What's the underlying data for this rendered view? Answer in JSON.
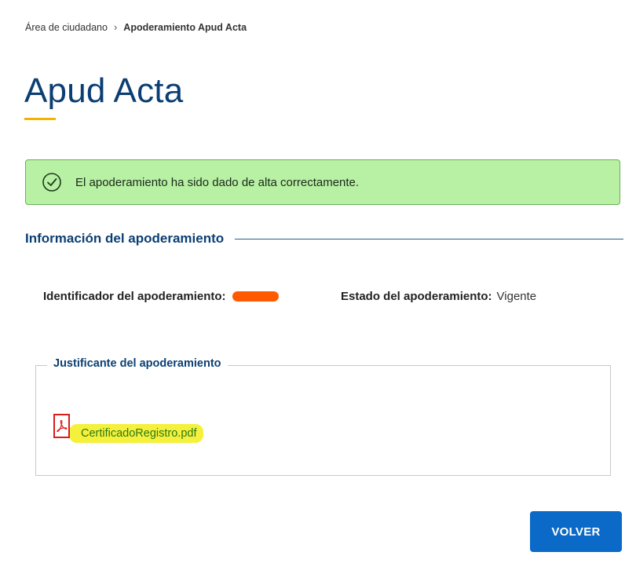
{
  "breadcrumb": {
    "home": "Área de ciudadano",
    "separator": "›",
    "current": "Apoderamiento Apud Acta"
  },
  "page": {
    "title": "Apud Acta"
  },
  "alert": {
    "icon": "check-circle-icon",
    "message": "El apoderamiento ha sido dado de alta correctamente."
  },
  "info_section": {
    "heading": "Información del apoderamiento",
    "identifier_label": "Identificador del apoderamiento:",
    "state_label": "Estado del apoderamiento:",
    "state_value": "Vigente"
  },
  "justificante": {
    "legend": "Justificante del apoderamiento",
    "file_icon": "pdf-icon",
    "file_name": "CertificadoRegistro.pdf"
  },
  "actions": {
    "back_label": "VOLVER"
  },
  "colors": {
    "primary": "#0b3f73",
    "button": "#0b69c7",
    "success_bg": "#b8f0a4",
    "accent_underline": "#f1b400",
    "pdf_red": "#d91c1c",
    "highlight": "#f5f03c",
    "redaction": "#ff5a00"
  }
}
